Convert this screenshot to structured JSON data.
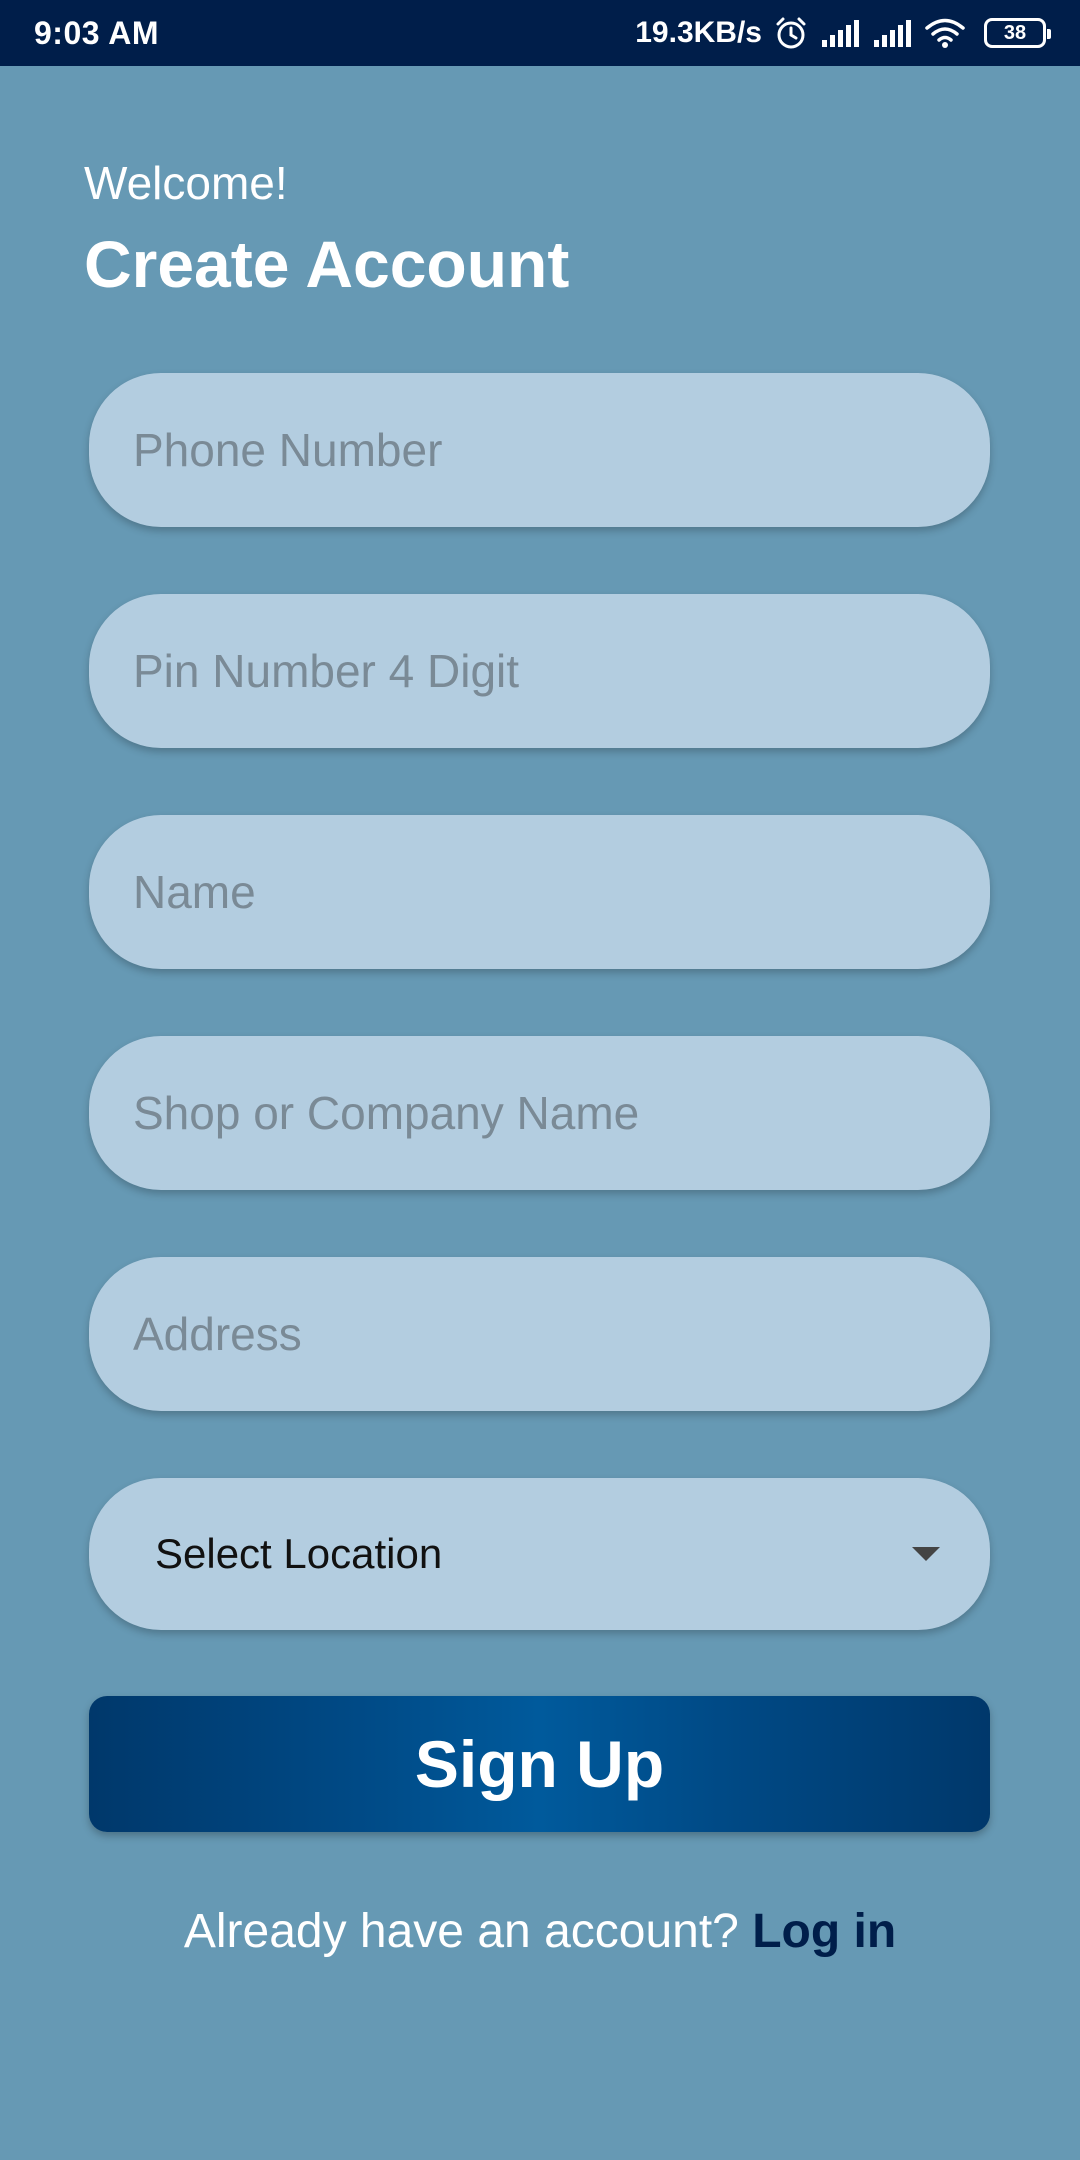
{
  "status_bar": {
    "time": "9:03 AM",
    "network_speed": "19.3KB/s",
    "battery": "38",
    "icons": [
      "alarm-icon",
      "signal-icon",
      "signal-icon",
      "wifi-icon",
      "battery-icon"
    ]
  },
  "header": {
    "welcome": "Welcome!",
    "title": "Create Account"
  },
  "form": {
    "phone": {
      "placeholder": "Phone Number",
      "value": ""
    },
    "pin": {
      "placeholder": "Pin Number 4 Digit",
      "value": ""
    },
    "name": {
      "placeholder": "Name",
      "value": ""
    },
    "shop": {
      "placeholder": "Shop or Company Name",
      "value": ""
    },
    "address": {
      "placeholder": "Address",
      "value": ""
    },
    "location": {
      "selected": "Select Location"
    }
  },
  "actions": {
    "signup_label": "Sign Up"
  },
  "footer": {
    "prompt": "Already have an account? ",
    "login_label": "Log in"
  },
  "colors": {
    "background": "#6699b4",
    "status_bar": "#001e4a",
    "field": "#b3cde0",
    "button": "#004a86",
    "link": "#001e4a"
  }
}
